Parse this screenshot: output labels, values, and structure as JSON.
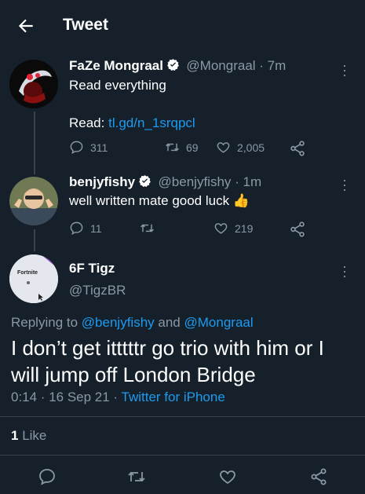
{
  "header": {
    "title": "Tweet"
  },
  "tweets": [
    {
      "name": "FaZe Mongraal",
      "handle": "@Mongraal · 7m",
      "text": "Read everything",
      "read_prefix": "Read:",
      "link": "tl.gd/n_1srqpcl",
      "replies": "311",
      "retweets": "69",
      "likes": "2,005"
    },
    {
      "name": "benjyfishy",
      "handle": "@benjyfishy · 1m",
      "text": "well written mate good luck",
      "emoji": "👍",
      "replies": "11",
      "retweets": "",
      "likes": "219"
    }
  ],
  "main_tweet": {
    "name": "6F Tigz",
    "handle": "@TigzBR",
    "avatar_text": "Fortnite",
    "replying_prefix": "Replying to",
    "replying_to_1": "@benjyfishy",
    "replying_and": "and",
    "replying_to_2": "@Mongraal",
    "text_line1": "I don’t get itttttr go trio with him or I",
    "text_line2": "will jump off London Bridge",
    "timestamp": "0:14 · 16 Sep 21 ·",
    "source": "Twitter for iPhone",
    "likes_count": "1",
    "likes_label": "Like"
  },
  "colors": {
    "background": "#15202b",
    "accent": "#1d9bf0",
    "muted": "#8b98a5",
    "divider": "#38444d"
  },
  "icons": [
    "back-arrow-icon",
    "verified-icon",
    "more-icon",
    "reply-icon",
    "retweet-icon",
    "like-icon",
    "share-icon"
  ]
}
